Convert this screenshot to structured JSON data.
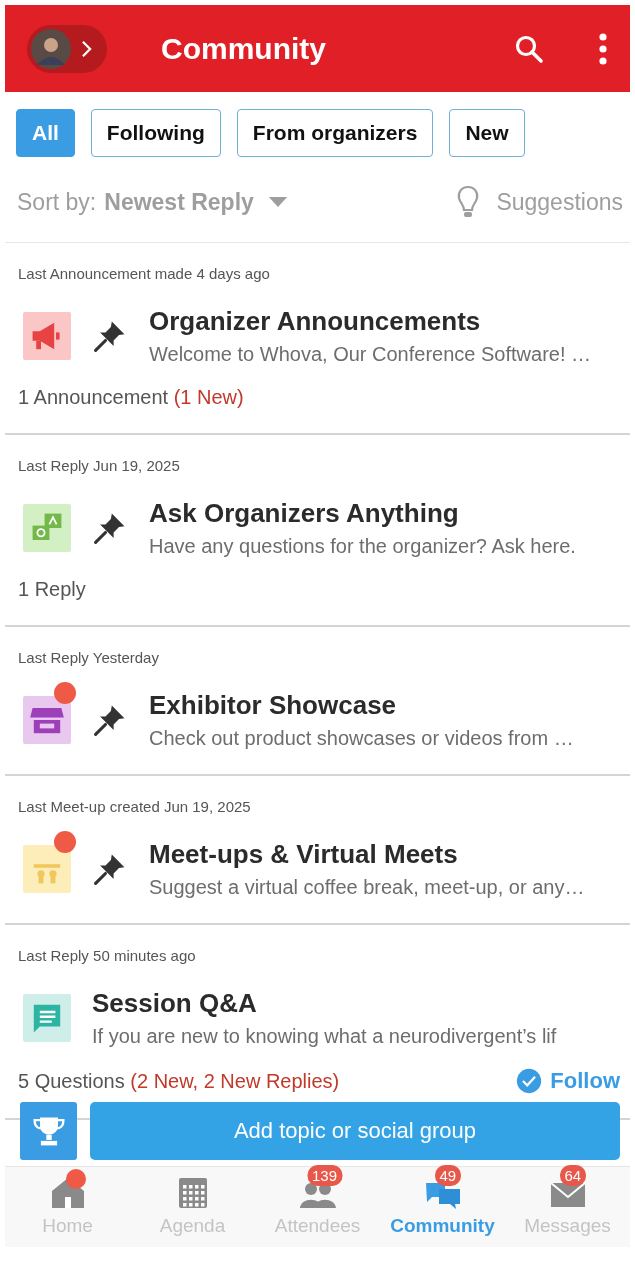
{
  "header": {
    "title": "Community"
  },
  "filters": [
    {
      "label": "All",
      "selected": true
    },
    {
      "label": "Following",
      "selected": false
    },
    {
      "label": "From organizers",
      "selected": false
    },
    {
      "label": "New",
      "selected": false
    }
  ],
  "sort": {
    "label": "Sort by:",
    "value": "Newest Reply",
    "suggestions": "Suggestions"
  },
  "topics": [
    {
      "meta": "Last Announcement made 4 days ago",
      "kind": "megaphone",
      "dot": false,
      "pinned": true,
      "title": "Organizer Announcements",
      "description": "Welcome to Whova, Our Conference Software! …",
      "count": "1 Announcement",
      "count_new": "(1 New)"
    },
    {
      "meta": "Last Reply Jun 19, 2025",
      "kind": "qa",
      "dot": false,
      "pinned": true,
      "title": "Ask Organizers Anything",
      "description": "Have any questions for the organizer? Ask here.",
      "count": "1 Reply"
    },
    {
      "meta": "Last Reply Yesterday",
      "kind": "store",
      "dot": true,
      "pinned": true,
      "title": "Exhibitor Showcase",
      "description": "Check out product showcases or videos from …"
    },
    {
      "meta": "Last Meet-up created Jun 19, 2025",
      "kind": "meetup",
      "dot": true,
      "pinned": true,
      "title": "Meet-ups & Virtual Meets",
      "description": "Suggest a virtual coffee break, meet-up, or any…"
    },
    {
      "meta": "Last Reply 50 minutes ago",
      "kind": "chat",
      "dot": false,
      "pinned": false,
      "title": "Session Q&A",
      "description": "If you are new to knowing what a neurodivergent’s lif",
      "count": "5 Questions",
      "count_new": "(2 New, 2 New Replies)",
      "follow": "Follow"
    }
  ],
  "add_button": "Add topic or social group",
  "nav": [
    {
      "label": "Home",
      "kind": "home",
      "selected": false,
      "dot": true
    },
    {
      "label": "Agenda",
      "kind": "agenda",
      "selected": false,
      "dot": false
    },
    {
      "label": "Attendees",
      "kind": "people",
      "selected": false,
      "dot": false,
      "badge": "139"
    },
    {
      "label": "Community",
      "kind": "chat",
      "selected": true,
      "dot": false,
      "badge": "49"
    },
    {
      "label": "Messages",
      "kind": "mail",
      "selected": false,
      "dot": false,
      "badge": "64"
    }
  ]
}
